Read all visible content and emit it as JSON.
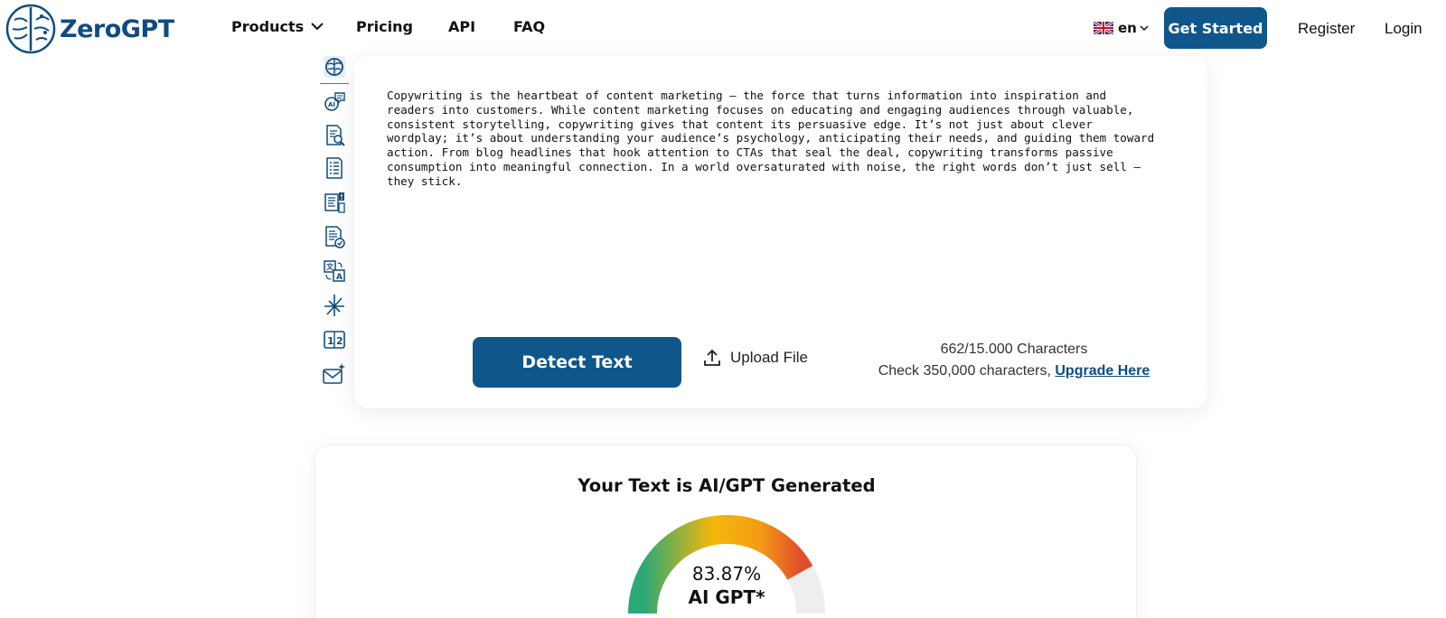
{
  "brand": {
    "name": "ZeroGPT",
    "color": "#0f4c81"
  },
  "nav": {
    "products": "Products",
    "pricing": "Pricing",
    "api": "API",
    "faq": "FAQ",
    "language": "en",
    "get_started": "Get Started",
    "register": "Register",
    "login": "Login"
  },
  "tools": [
    {
      "icon": "brain-icon"
    },
    {
      "icon": "ai-chat-icon"
    },
    {
      "icon": "document-search-icon"
    },
    {
      "icon": "document-list-icon"
    },
    {
      "icon": "report-alert-icon"
    },
    {
      "icon": "document-check-icon"
    },
    {
      "icon": "translate-icon"
    },
    {
      "icon": "sparkle-icon"
    },
    {
      "icon": "counter-icon"
    },
    {
      "icon": "email-sparkle-icon"
    }
  ],
  "input": {
    "text": "Copywriting is the heartbeat of content marketing — the force that turns information into inspiration and\nreaders into customers. While content marketing focuses on educating and engaging audiences through valuable,\nconsistent storytelling, copywriting gives that content its persuasive edge. It’s not just about clever\nwordplay; it’s about understanding your audience’s psychology, anticipating their needs, and guiding them toward\naction. From blog headlines that hook attention to CTAs that seal the deal, copywriting transforms passive\nconsumption into meaningful connection. In a world oversaturated with noise, the right words don’t just sell —\nthey stick.",
    "detect_button": "Detect Text",
    "upload_label": "Upload File",
    "char_count": "662/15.000 Characters",
    "check_prefix": "Check 350,000 characters,",
    "upgrade_label": "Upgrade Here"
  },
  "result": {
    "title": "Your Text is AI/GPT Generated",
    "ai_percent": 83.87,
    "ai_percent_label": "83.87%",
    "label": "AI GPT*"
  },
  "colors": {
    "primary_button": "#0f568a",
    "gauge_green": "#2aa876",
    "gauge_yellow": "#f5b80a",
    "gauge_red": "#e04e2a",
    "gauge_track": "#eeeeef"
  }
}
